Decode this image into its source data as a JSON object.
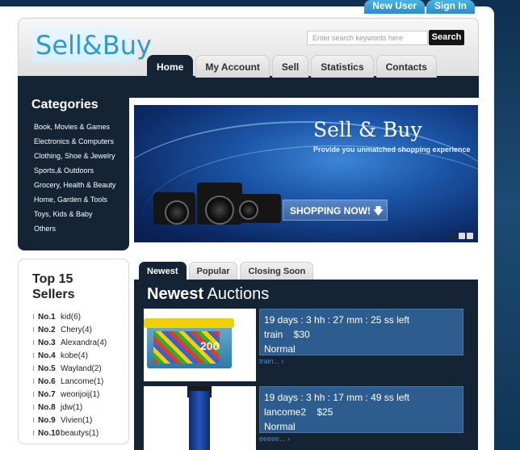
{
  "top_links": {
    "new_user": "New User",
    "sign_in": "Sign In"
  },
  "logo": {
    "text": "Sell&Buy"
  },
  "search": {
    "placeholder": "Enter search keywords here",
    "button": "Search"
  },
  "nav": [
    {
      "label": "Home",
      "active": true
    },
    {
      "label": "My Account",
      "active": false
    },
    {
      "label": "Sell",
      "active": false
    },
    {
      "label": "Statistics",
      "active": false
    },
    {
      "label": "Contacts",
      "active": false
    }
  ],
  "categories": {
    "title": "Categories",
    "items": [
      "Book, Movies & Games",
      "Electronics & Computers",
      "Clothing, Shoe & Jewelry",
      "Sports,& Outdoors",
      "Grocery, Health & Beauty",
      "Home, Garden & Tools",
      "Toys, Kids & Baby",
      "Others"
    ]
  },
  "banner": {
    "title": "Sell & Buy",
    "subtitle": "Provide you unmatched shopping experience",
    "button": "SHOPPING NOW! 🡇",
    "slides": 3,
    "active_slide": 1
  },
  "top_sellers": {
    "title": "Top 15 Sellers",
    "items": [
      {
        "rank": "No.1",
        "name": "kid(6)"
      },
      {
        "rank": "No.2",
        "name": "Chery(4)"
      },
      {
        "rank": "No.3",
        "name": "Alexandra(4)"
      },
      {
        "rank": "No.4",
        "name": "kobe(4)"
      },
      {
        "rank": "No.5",
        "name": "Wayland(2)"
      },
      {
        "rank": "No.6",
        "name": "Lancome(1)"
      },
      {
        "rank": "No.7",
        "name": "weorijoij(1)"
      },
      {
        "rank": "No.8",
        "name": "jdw(1)"
      },
      {
        "rank": "No.9",
        "name": "Vivien(1)"
      },
      {
        "rank": "No.10",
        "name": "beautys(1)"
      }
    ]
  },
  "auction_tabs": [
    {
      "label": "Newest",
      "active": true
    },
    {
      "label": "Popular",
      "active": false
    },
    {
      "label": "Closing Soon",
      "active": false
    }
  ],
  "auctions_section": {
    "title_bold": "Newest",
    "title_rest": " Auctions"
  },
  "auctions": [
    {
      "time_left": "19 days : 3 hh : 27 mm : 25 ss left",
      "name_price": "train    $30",
      "condition": "Normal",
      "link": "train...  ›"
    },
    {
      "time_left": "19 days : 3 hh : 17 mm : 49 ss left",
      "name_price": "lancome2    $25",
      "condition": "Normal",
      "link": "eeeee...  ›"
    }
  ],
  "colors": {
    "dark_panel": "#152434",
    "accent_blue": "#2a8dc8",
    "auction_box": "#2c5d8e"
  }
}
